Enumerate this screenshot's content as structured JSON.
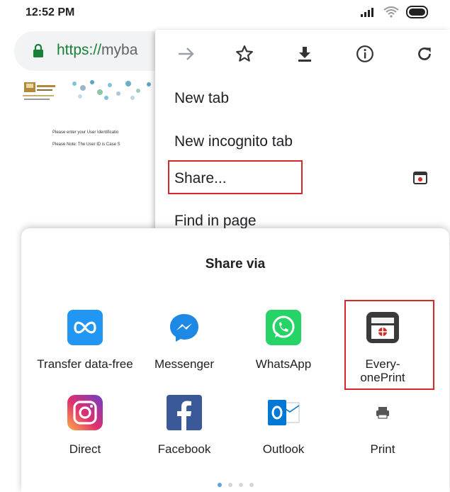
{
  "status_bar": {
    "time": "12:52 PM"
  },
  "browser": {
    "url_scheme": "https://",
    "url_host": "myba"
  },
  "page": {
    "line1": "Please enter your User Identificatio",
    "line2": "Please Note: The User ID is Case S"
  },
  "menu": {
    "toolbar_icons": [
      "forward-arrow-icon",
      "star-icon",
      "download-icon",
      "info-icon",
      "reload-icon"
    ],
    "items": [
      {
        "label": "New tab"
      },
      {
        "label": "New incognito tab"
      },
      {
        "label": "Share..."
      },
      {
        "label": "Find in page"
      }
    ]
  },
  "share_sheet": {
    "title": "Share via",
    "apps": [
      {
        "label": "Transfer data-free",
        "icon": "infinity-icon",
        "color": "#2196f3"
      },
      {
        "label": "Messenger",
        "icon": "messenger-icon",
        "color": "#1e88e5"
      },
      {
        "label": "WhatsApp",
        "icon": "whatsapp-icon",
        "color": "#25d366"
      },
      {
        "label": "Every-onePrint",
        "icon": "printer-app-icon",
        "color": "#333333"
      },
      {
        "label": "Direct",
        "icon": "instagram-icon",
        "color": "#c13584"
      },
      {
        "label": "Facebook",
        "icon": "facebook-icon",
        "color": "#3b5998"
      },
      {
        "label": "Outlook",
        "icon": "outlook-icon",
        "color": "#0078d4"
      },
      {
        "label": "Print",
        "icon": "print-icon",
        "color": "#555555"
      }
    ],
    "page_indicator": {
      "count": 4,
      "active": 0
    }
  }
}
